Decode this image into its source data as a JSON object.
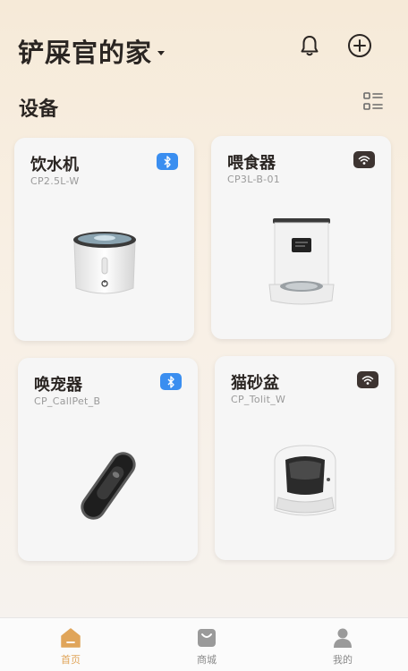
{
  "header": {
    "home_title": "铲屎官的家",
    "icons": [
      "bell-icon",
      "add-circle-icon"
    ]
  },
  "section": {
    "title": "设备",
    "layout_icon": "list-layout-icon"
  },
  "devices": [
    {
      "name": "饮水机",
      "model": "CP2.5L-W",
      "connection": "bluetooth-icon",
      "badge_color": "#3a8ef0"
    },
    {
      "name": "喂食器",
      "model": "CP3L-B-01",
      "connection": "wifi-icon",
      "badge_color": "#3d3431"
    },
    {
      "name": "唤宠器",
      "model": "CP_CallPet_B",
      "connection": "bluetooth-icon",
      "badge_color": "#3a8ef0"
    },
    {
      "name": "猫砂盆",
      "model": "CP_Tolit_W",
      "connection": "wifi-icon",
      "badge_color": "#3d3431"
    }
  ],
  "tabbar": {
    "active": "首页",
    "accent_color": "#e0a55a",
    "items": [
      {
        "label": "首页",
        "icon": "home-icon"
      },
      {
        "label": "商城",
        "icon": "shop-icon"
      },
      {
        "label": "我的",
        "icon": "profile-icon"
      }
    ]
  }
}
